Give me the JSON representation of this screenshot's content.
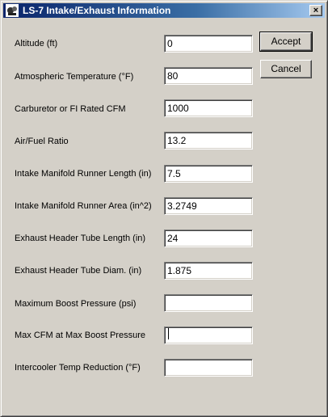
{
  "window": {
    "title": "LS-7 Intake/Exhaust Information",
    "close_glyph": "×",
    "icon": "app-icon"
  },
  "fields": [
    {
      "label": "Altitude (ft)",
      "value": "0"
    },
    {
      "label": "Atmospheric Temperature (°F)",
      "value": "80"
    },
    {
      "label": "Carburetor or FI Rated CFM",
      "value": "1000"
    },
    {
      "label": "Air/Fuel Ratio",
      "value": "13.2"
    },
    {
      "label": "Intake Manifold Runner Length (in)",
      "value": "7.5"
    },
    {
      "label": "Intake Manifold Runner Area (in^2)",
      "value": "3.2749"
    },
    {
      "label": "Exhaust Header Tube Length (in)",
      "value": "24"
    },
    {
      "label": "Exhaust Header Tube Diam. (in)",
      "value": "1.875"
    },
    {
      "label": "Maximum Boost Pressure (psi)",
      "value": ""
    },
    {
      "label": "Max CFM at Max Boost Pressure",
      "value": ""
    },
    {
      "label": "Intercooler Temp Reduction (°F)",
      "value": ""
    }
  ],
  "buttons": {
    "accept": "Accept",
    "cancel": "Cancel"
  },
  "colors": {
    "titlebar_start": "#0a246a",
    "titlebar_end": "#a6caf0",
    "face": "#d4d0c8"
  }
}
